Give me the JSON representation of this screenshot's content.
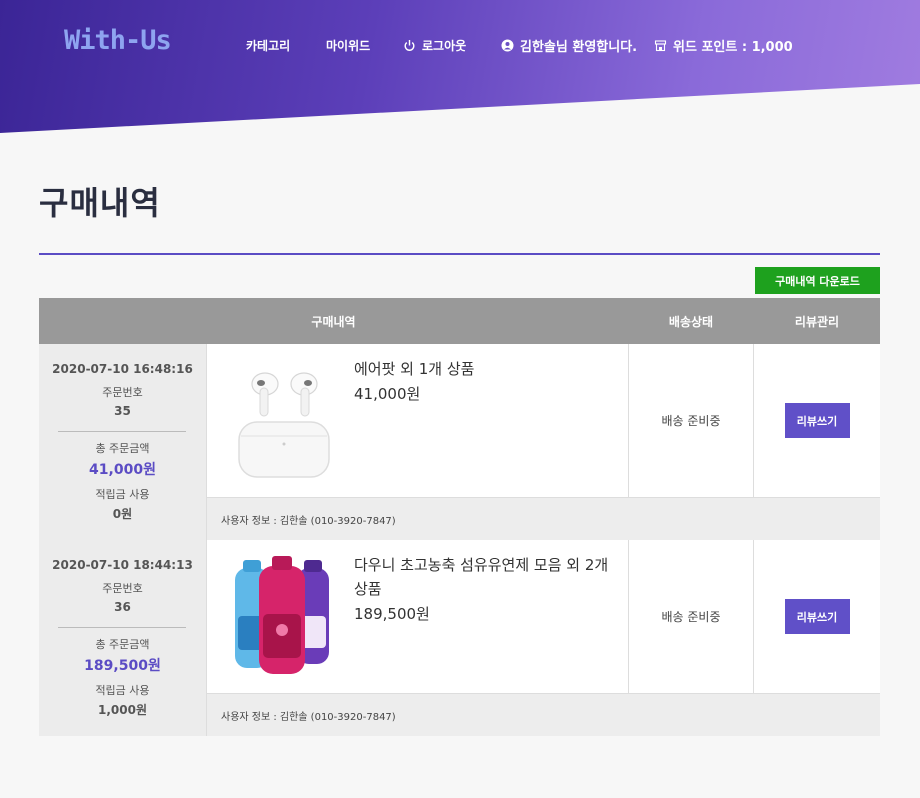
{
  "header": {
    "logo": "With-Us",
    "nav": {
      "category": "카테고리",
      "myweed": "마이위드",
      "logout": "로그아웃",
      "welcome": "김한솔님 환영합니다.",
      "points": "위드 포인트 : 1,000"
    },
    "icons": [
      "power-icon",
      "user-icon",
      "store-icon"
    ]
  },
  "page": {
    "title": "구매내역",
    "download_label": "구매내역 다운로드"
  },
  "table": {
    "headers": [
      "구매내역",
      "배송상태",
      "리뷰관리"
    ],
    "orders": [
      {
        "date": "2020-07-10 16:48:16",
        "order_no_label": "주문번호",
        "order_no": "35",
        "total_label": "총 주문금액",
        "total": "41,000원",
        "points_label": "적립금 사용",
        "points": "0원",
        "product_name": "에어팟 외 1개 상품",
        "product_price": "41,000원",
        "status": "배송 준비중",
        "review_label": "리뷰쓰기",
        "user_info": "사용자 정보 : 김한솔 (010-3920-7847)"
      },
      {
        "date": "2020-07-10 18:44:13",
        "order_no_label": "주문번호",
        "order_no": "36",
        "total_label": "총 주문금액",
        "total": "189,500원",
        "points_label": "적립금 사용",
        "points": "1,000원",
        "product_name": "다우니 초고농축 섬유유연제 모음 외 2개 상품",
        "product_price": "189,500원",
        "status": "배송 준비중",
        "review_label": "리뷰쓰기",
        "user_info": "사용자 정보 : 김한솔 (010-3920-7847)"
      }
    ]
  },
  "colors": {
    "accent": "#5b4cc4",
    "download": "#1ea11e",
    "header_gradient": [
      "#3b2596",
      "#a07ce0"
    ]
  }
}
